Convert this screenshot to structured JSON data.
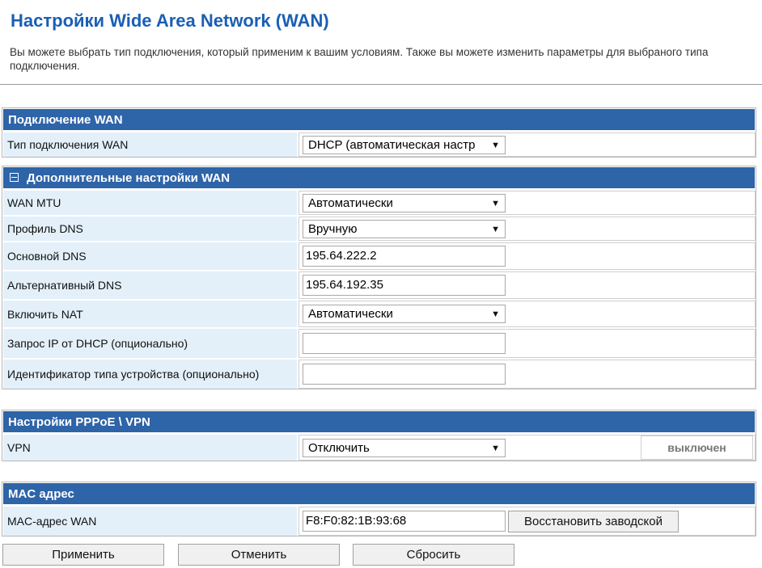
{
  "page": {
    "title": "Настройки Wide Area Network (WAN)",
    "description": "Вы можете выбрать тип подключения, который применим к вашим условиям. Также вы можете изменить параметры для выбраного типа подключения."
  },
  "wan_connection": {
    "header": "Подключение WAN",
    "type_label": "Тип подключения WAN",
    "type_value": "DHCP (автоматическая настр"
  },
  "advanced": {
    "header": "Дополнительные настройки WAN",
    "mtu_label": "WAN MTU",
    "mtu_value": "Автоматически",
    "dns_profile_label": "Профиль DNS",
    "dns_profile_value": "Вручную",
    "primary_dns_label": "Основной DNS",
    "primary_dns_value": "195.64.222.2",
    "alt_dns_label": "Альтернативный DNS",
    "alt_dns_value": "195.64.192.35",
    "nat_label": "Включить NAT",
    "nat_value": "Автоматически",
    "dhcp_ip_label": "Запрос IP от DHCP (опционально)",
    "dhcp_ip_value": "",
    "device_id_label": "Идентификатор типа устройства (опционально)",
    "device_id_value": ""
  },
  "pppoe": {
    "header": "Настройки PPPoE \\ VPN",
    "vpn_label": "VPN",
    "vpn_value": "Отключить",
    "vpn_status": "выключен"
  },
  "mac": {
    "header": "MAC адрес",
    "wan_mac_label": "MAC-адрес WAN",
    "wan_mac_value": "F8:F0:82:1B:93:68",
    "restore_label": "Восстановить заводской"
  },
  "actions": {
    "apply": "Применить",
    "cancel": "Отменить",
    "reset": "Сбросить"
  },
  "colors": {
    "title": "#1a5fb4",
    "section_header": "#2e64a8",
    "label_bg": "#e3f0fa"
  }
}
